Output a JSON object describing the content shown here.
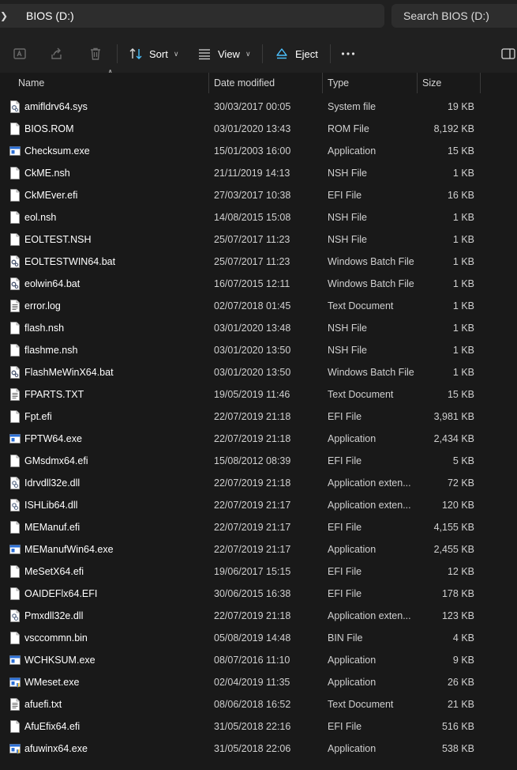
{
  "address": {
    "path": "BIOS (D:)"
  },
  "search": {
    "placeholder": "Search BIOS (D:)"
  },
  "toolbar": {
    "sort_label": "Sort",
    "view_label": "View",
    "eject_label": "Eject"
  },
  "columns": {
    "name": "Name",
    "date": "Date modified",
    "type": "Type",
    "size": "Size"
  },
  "files": [
    {
      "name": "amifldrv64.sys",
      "date": "30/03/2017 00:05",
      "type": "System file",
      "size": "19 KB",
      "icon": "system-file-icon"
    },
    {
      "name": "BIOS.ROM",
      "date": "03/01/2020 13:43",
      "type": "ROM File",
      "size": "8,192 KB",
      "icon": "file-icon"
    },
    {
      "name": "Checksum.exe",
      "date": "15/01/2003 16:00",
      "type": "Application",
      "size": "15 KB",
      "icon": "application-icon"
    },
    {
      "name": "CkME.nsh",
      "date": "21/11/2019 14:13",
      "type": "NSH File",
      "size": "1 KB",
      "icon": "file-icon"
    },
    {
      "name": "CkMEver.efi",
      "date": "27/03/2017 10:38",
      "type": "EFI File",
      "size": "16 KB",
      "icon": "file-icon"
    },
    {
      "name": "eol.nsh",
      "date": "14/08/2015 15:08",
      "type": "NSH File",
      "size": "1 KB",
      "icon": "file-icon"
    },
    {
      "name": "EOLTEST.NSH",
      "date": "25/07/2017 11:23",
      "type": "NSH File",
      "size": "1 KB",
      "icon": "file-icon"
    },
    {
      "name": "EOLTESTWIN64.bat",
      "date": "25/07/2017 11:23",
      "type": "Windows Batch File",
      "size": "1 KB",
      "icon": "batch-file-icon"
    },
    {
      "name": "eolwin64.bat",
      "date": "16/07/2015 12:11",
      "type": "Windows Batch File",
      "size": "1 KB",
      "icon": "batch-file-icon"
    },
    {
      "name": "error.log",
      "date": "02/07/2018 01:45",
      "type": "Text Document",
      "size": "1 KB",
      "icon": "text-document-icon"
    },
    {
      "name": "flash.nsh",
      "date": "03/01/2020 13:48",
      "type": "NSH File",
      "size": "1 KB",
      "icon": "file-icon"
    },
    {
      "name": "flashme.nsh",
      "date": "03/01/2020 13:50",
      "type": "NSH File",
      "size": "1 KB",
      "icon": "file-icon"
    },
    {
      "name": "FlashMeWinX64.bat",
      "date": "03/01/2020 13:50",
      "type": "Windows Batch File",
      "size": "1 KB",
      "icon": "batch-file-icon"
    },
    {
      "name": "FPARTS.TXT",
      "date": "19/05/2019 11:46",
      "type": "Text Document",
      "size": "15 KB",
      "icon": "text-document-icon"
    },
    {
      "name": "Fpt.efi",
      "date": "22/07/2019 21:18",
      "type": "EFI File",
      "size": "3,981 KB",
      "icon": "file-icon"
    },
    {
      "name": "FPTW64.exe",
      "date": "22/07/2019 21:18",
      "type": "Application",
      "size": "2,434 KB",
      "icon": "application-icon"
    },
    {
      "name": "GMsdmx64.efi",
      "date": "15/08/2012 08:39",
      "type": "EFI File",
      "size": "5 KB",
      "icon": "file-icon"
    },
    {
      "name": "Idrvdll32e.dll",
      "date": "22/07/2019 21:18",
      "type": "Application exten...",
      "size": "72 KB",
      "icon": "dll-file-icon"
    },
    {
      "name": "ISHLib64.dll",
      "date": "22/07/2019 21:17",
      "type": "Application exten...",
      "size": "120 KB",
      "icon": "dll-file-icon"
    },
    {
      "name": "MEManuf.efi",
      "date": "22/07/2019 21:17",
      "type": "EFI File",
      "size": "4,155 KB",
      "icon": "file-icon"
    },
    {
      "name": "MEManufWin64.exe",
      "date": "22/07/2019 21:17",
      "type": "Application",
      "size": "2,455 KB",
      "icon": "application-icon"
    },
    {
      "name": "MeSetX64.efi",
      "date": "19/06/2017 15:15",
      "type": "EFI File",
      "size": "12 KB",
      "icon": "file-icon"
    },
    {
      "name": "OAIDEFlx64.EFI",
      "date": "30/06/2015 16:38",
      "type": "EFI File",
      "size": "178 KB",
      "icon": "file-icon"
    },
    {
      "name": "Pmxdll32e.dll",
      "date": "22/07/2019 21:18",
      "type": "Application exten...",
      "size": "123 KB",
      "icon": "dll-file-icon"
    },
    {
      "name": "vsccommn.bin",
      "date": "05/08/2019 14:48",
      "type": "BIN File",
      "size": "4 KB",
      "icon": "file-icon"
    },
    {
      "name": "WCHKSUM.exe",
      "date": "08/07/2016 11:10",
      "type": "Application",
      "size": "9 KB",
      "icon": "application-icon"
    },
    {
      "name": "WMeset.exe",
      "date": "02/04/2019 11:35",
      "type": "Application",
      "size": "26 KB",
      "icon": "application-shield-icon"
    },
    {
      "name": "afuefi.txt",
      "date": "08/06/2018 16:52",
      "type": "Text Document",
      "size": "21 KB",
      "icon": "text-document-icon"
    },
    {
      "name": "AfuEfix64.efi",
      "date": "31/05/2018 22:16",
      "type": "EFI File",
      "size": "516 KB",
      "icon": "file-icon"
    },
    {
      "name": "afuwinx64.exe",
      "date": "31/05/2018 22:06",
      "type": "Application",
      "size": "538 KB",
      "icon": "application-shield-icon"
    }
  ]
}
